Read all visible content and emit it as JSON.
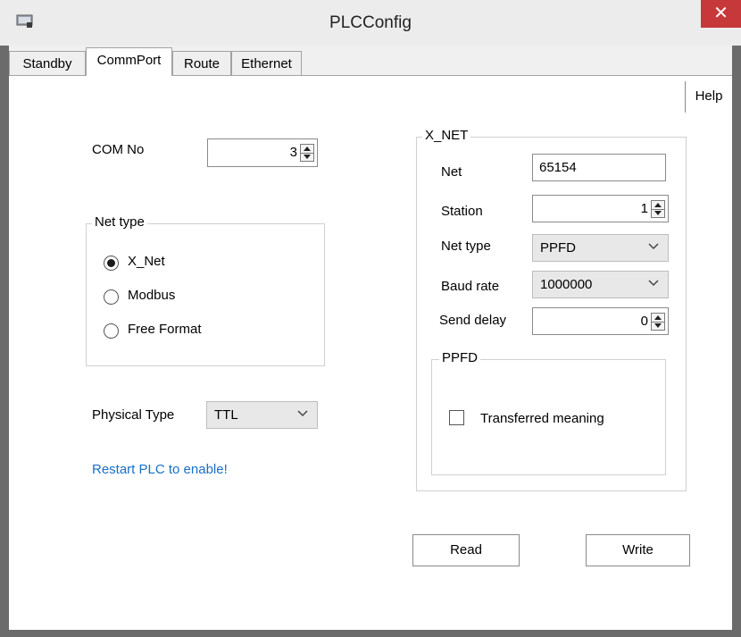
{
  "window": {
    "title": "PLCConfig",
    "close_glyph": "✕",
    "app_icon": "app-icon",
    "close_color": "#c7383b"
  },
  "tabs": [
    {
      "label": "Standby",
      "active": false
    },
    {
      "label": "CommPort",
      "active": true
    },
    {
      "label": "Route",
      "active": false
    },
    {
      "label": "Ethernet",
      "active": false
    }
  ],
  "help_label": "Help",
  "com": {
    "label": "COM No",
    "value": "3"
  },
  "net_type_group": {
    "legend": "Net type",
    "options": [
      {
        "label": "X_Net",
        "selected": true
      },
      {
        "label": "Modbus",
        "selected": false
      },
      {
        "label": "Free Format",
        "selected": false
      }
    ]
  },
  "physical": {
    "label": "Physical Type",
    "value": "TTL"
  },
  "restart_note": "Restart PLC to enable!",
  "xnet": {
    "legend": "X_NET",
    "net_label": "Net",
    "net_value": "65154",
    "station_label": "Station",
    "station_value": "1",
    "net_type_label": "Net type",
    "net_type_value": "PPFD",
    "baud_label": "Baud rate",
    "baud_value": "1000000",
    "send_delay_label": "Send delay",
    "send_delay_value": "0",
    "ppfd": {
      "legend": "PPFD",
      "transferred_label": "Transferred meaning",
      "transferred_checked": false
    }
  },
  "buttons": {
    "read": "Read",
    "write": "Write"
  },
  "colors": {
    "link": "#1a6fc4",
    "window_frame": "#6b6b6b"
  }
}
